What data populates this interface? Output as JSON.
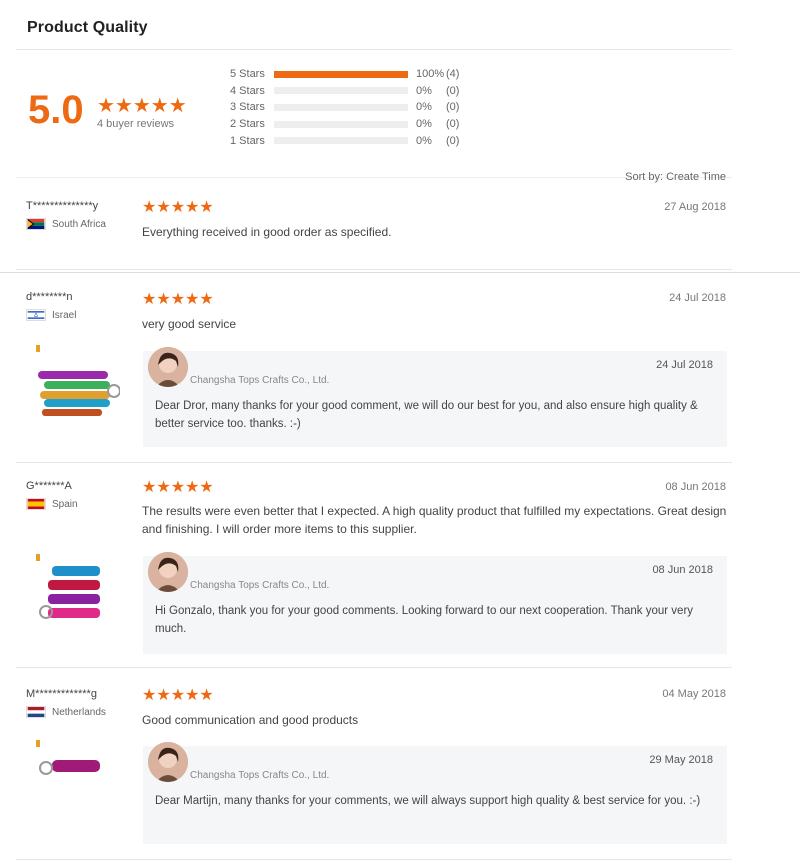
{
  "header": {
    "title": "Product Quality"
  },
  "summary": {
    "score": "5.0",
    "stars": "★★★★★",
    "buyer_reviews": "4 buyer reviews",
    "distribution": [
      {
        "label": "5 Stars",
        "percent": "100%",
        "count": "(4)",
        "fill": 1.0
      },
      {
        "label": "4 Stars",
        "percent": "0%",
        "count": "(0)",
        "fill": 0
      },
      {
        "label": "3 Stars",
        "percent": "0%",
        "count": "(0)",
        "fill": 0
      },
      {
        "label": "2 Stars",
        "percent": "0%",
        "count": "(0)",
        "fill": 0
      },
      {
        "label": "1 Stars",
        "percent": "0%",
        "count": "(0)",
        "fill": 0
      }
    ]
  },
  "sort": {
    "label": "Sort by: Create Time"
  },
  "colors": {
    "accent": "#ee6a12",
    "reply_bg": "#f5f6f8"
  },
  "reviews": [
    {
      "name": "T**************y",
      "country": "South Africa",
      "stars": "★★★★★",
      "date": "27 Aug 2018",
      "text": "Everything received in good order as specified."
    },
    {
      "name": "d********n",
      "country": "Israel",
      "stars": "★★★★★",
      "date": "24 Jul 2018",
      "text": "very good service",
      "reply": {
        "seller": "Changsha Tops Crafts Co., Ltd.",
        "date": "24 Jul 2018",
        "text": "Dear Dror, many thanks for your good comment, we will do our best for you, and also ensure high quality & better service too. thanks. :-)"
      }
    },
    {
      "name": "G*******A",
      "country": "Spain",
      "stars": "★★★★★",
      "date": "08 Jun 2018",
      "text": "The results were even better that I expected. A high quality product that fulfilled my expectations. Great design and finishing. I will order more items to this supplier.",
      "reply": {
        "seller": "Changsha Tops Crafts Co., Ltd.",
        "date": "08 Jun 2018",
        "text": "Hi Gonzalo, thank you for your good comments. Looking forward to our next cooperation. Thank your very much."
      }
    },
    {
      "name": "M*************g",
      "country": "Netherlands",
      "stars": "★★★★★",
      "date": "04 May 2018",
      "text": "Good communication and good products",
      "reply": {
        "seller": "Changsha Tops Crafts Co., Ltd.",
        "date": "29 May 2018",
        "text": "Dear Martijn, many thanks for your comments, we will always support high quality & best service for you. :-)"
      }
    }
  ]
}
